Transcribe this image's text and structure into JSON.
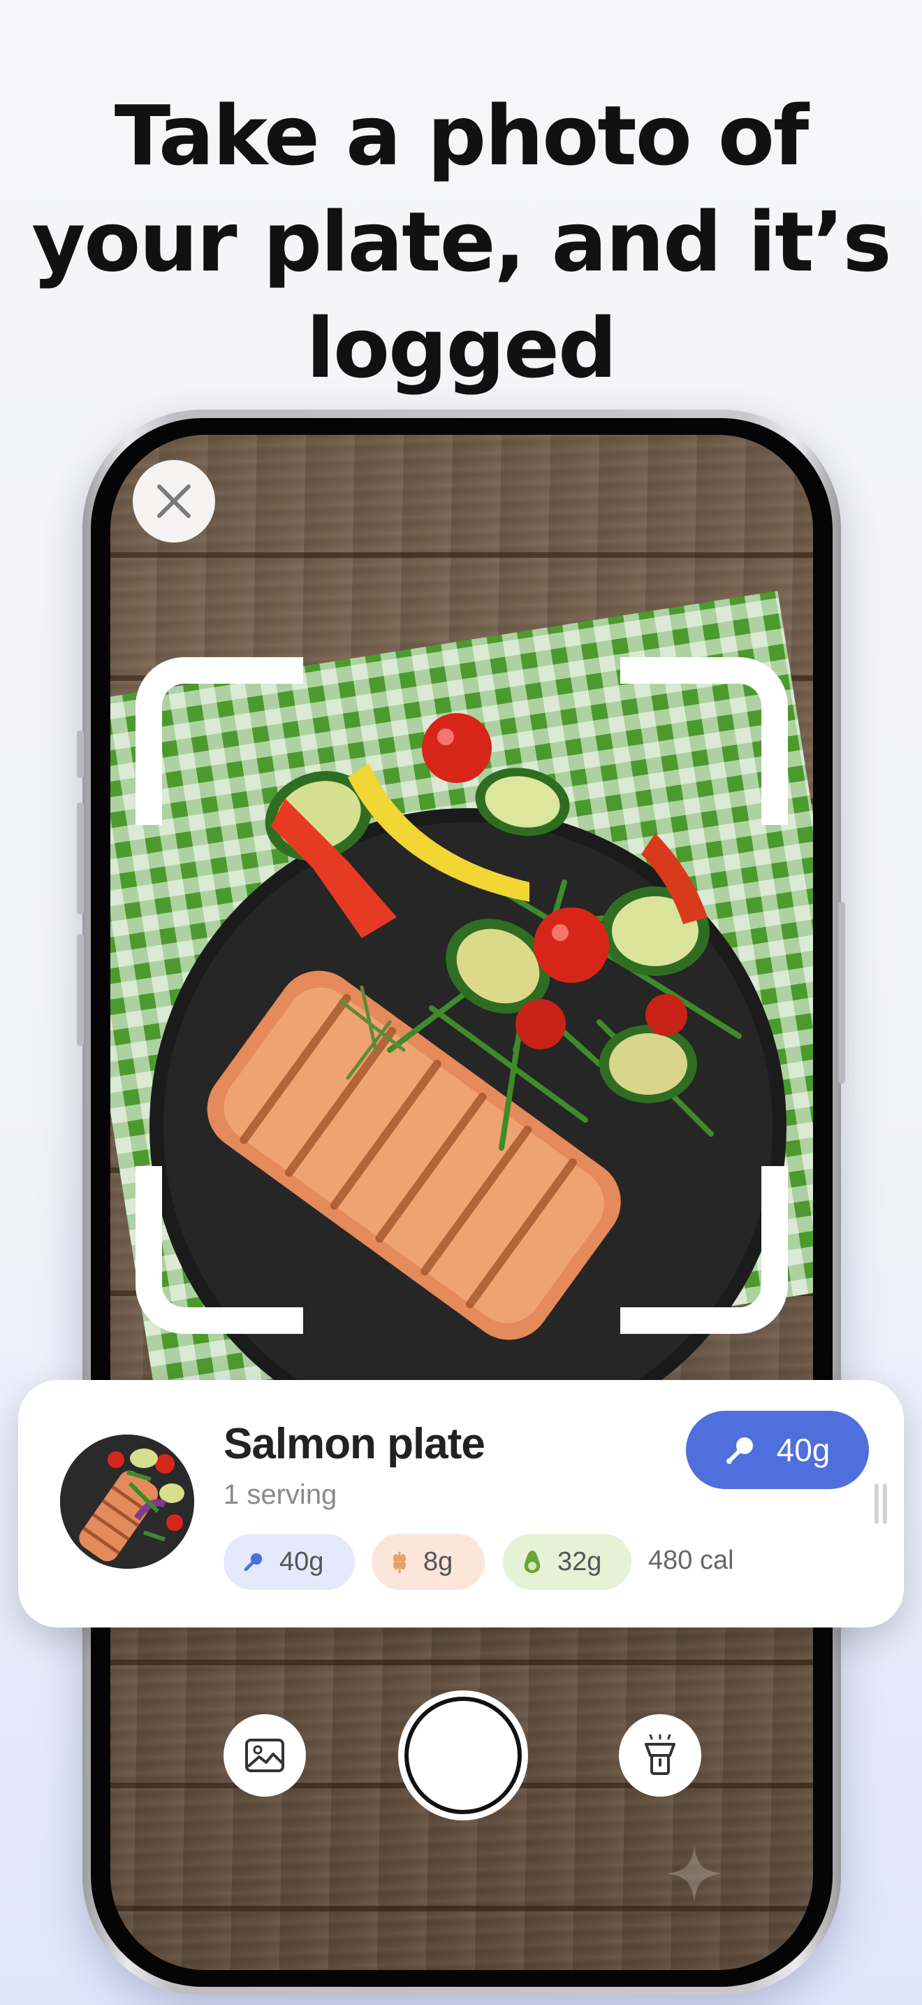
{
  "headline": {
    "line1": "Take a photo of",
    "line2": "your plate, and it’s",
    "line3": "logged"
  },
  "camera": {
    "close_icon": "close-icon",
    "gallery_icon": "gallery-icon",
    "flash_icon": "flashlight-icon",
    "shutter": "shutter-button"
  },
  "result": {
    "name": "Salmon plate",
    "serving": "1 serving",
    "protein_button": "40g",
    "macros": {
      "protein": "40g",
      "carbs": "8g",
      "fat": "32g",
      "calories": "480 cal"
    }
  },
  "colors": {
    "accent_blue": "#4e6fdc",
    "protein_chip": "#e4e9fb",
    "carbs_chip": "#fbe6d9",
    "fat_chip": "#e5f2d6",
    "carbs_icon": "#e2a268",
    "fat_icon": "#6aa53c"
  }
}
